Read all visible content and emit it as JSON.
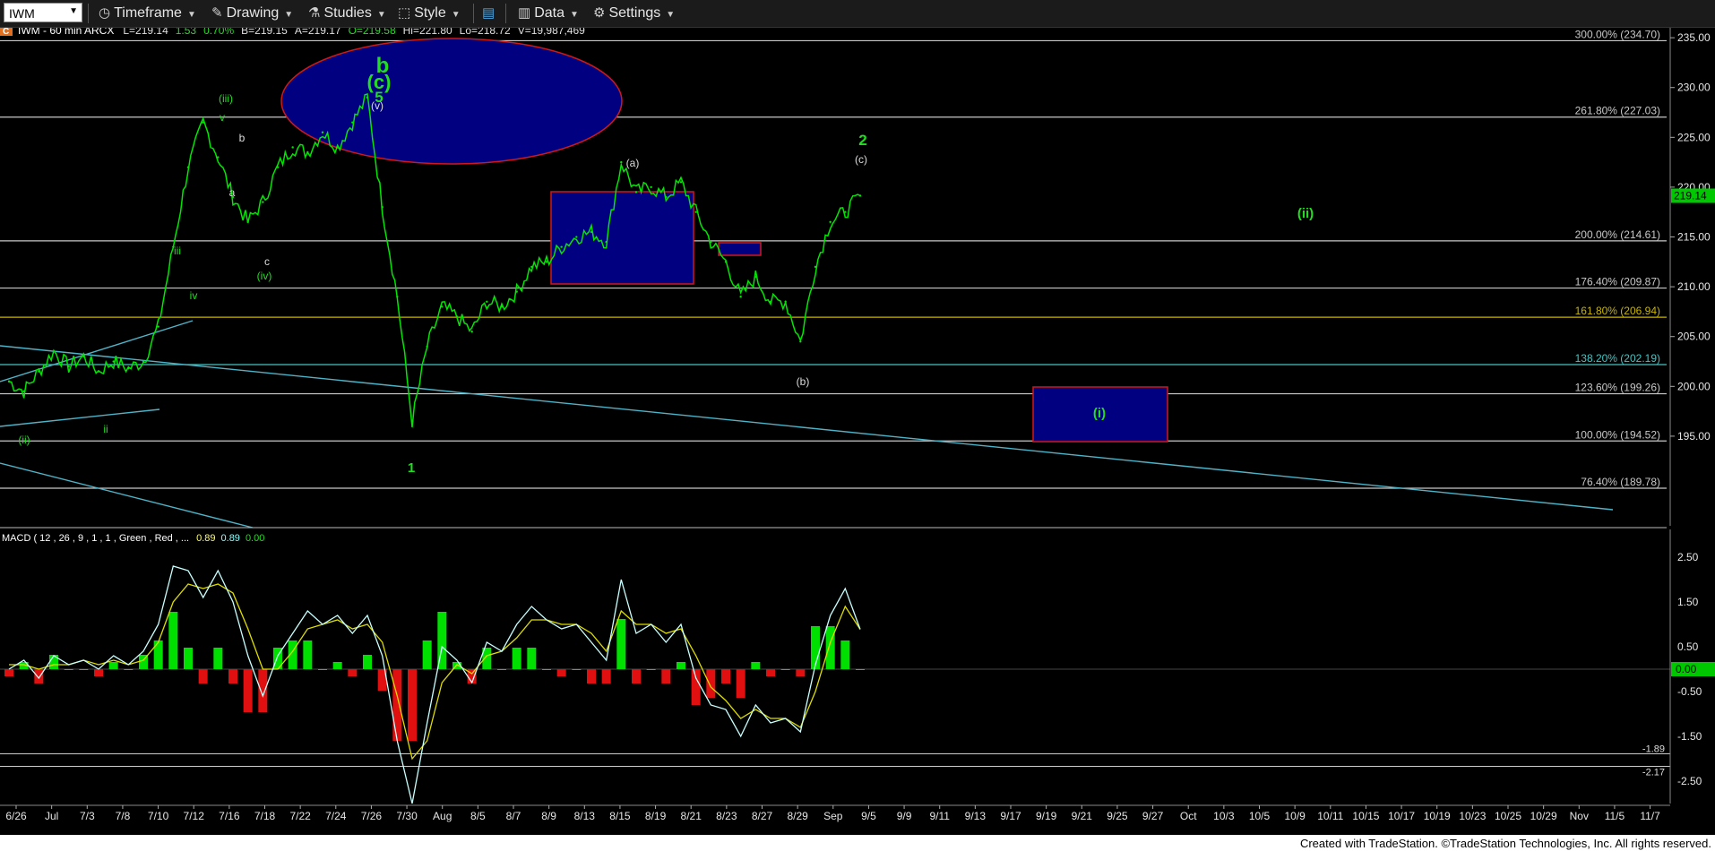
{
  "toolbar": {
    "symbol": "IWM",
    "timeframe_label": "Timeframe",
    "drawing_label": "Drawing",
    "studies_label": "Studies",
    "style_label": "Style",
    "data_label": "Data",
    "settings_label": "Settings",
    "icons": [
      "clock-icon",
      "pencil-icon",
      "flask-icon",
      "style-icon",
      "layout-icon",
      "bar-chart-icon",
      "gear-icon"
    ]
  },
  "header": {
    "marker": "C",
    "title": "IWM - 60 min  ARCX",
    "last": "L=219.14",
    "change": "1.53",
    "change_pct": "0.70%",
    "bid": "B=219.15",
    "ask": "A=219.17",
    "open": "O=219.58",
    "high": "Hi=221.80",
    "low": "Lo=218.72",
    "volume": "V=19,987,469"
  },
  "macd_header": {
    "label": "MACD ( 12 , 26 , 9 , 1 , 1 , Green , Red , ...",
    "v1": "0.89",
    "v2": "0.89",
    "v3": "0.00"
  },
  "colors": {
    "bg": "#000000",
    "price": "#00e600",
    "fib": "#c8c8c8",
    "fib_gold": "#c8b400",
    "fib_cyan": "#44c4c4",
    "box_fill": "#000080",
    "box_border": "#d01818",
    "trend": "#4fb3c8",
    "wave_green": "#22dd22",
    "wave_white": "#dddddd",
    "macd_pos": "#00e000",
    "macd_neg": "#e01010",
    "macd_line": "#c8ffff",
    "signal_line": "#dddd00"
  },
  "chart_data": {
    "type": "line",
    "ticker": "IWM",
    "interval": "60 min",
    "ylim": [
      186,
      236
    ],
    "y_ticks": [
      195,
      200,
      205,
      210,
      215,
      220,
      225,
      230,
      235
    ],
    "y_tick_labels": [
      "195.00",
      "200.00",
      "205.00",
      "210.00",
      "215.00",
      "220.00",
      "225.00",
      "230.00",
      "235.00"
    ],
    "last_price_tag": "219.14",
    "x_tick_labels": [
      "6/26",
      "Jul",
      "7/3",
      "7/8",
      "7/10",
      "7/12",
      "7/16",
      "7/18",
      "7/22",
      "7/24",
      "7/26",
      "7/30",
      "Aug",
      "8/5",
      "8/7",
      "8/9",
      "8/13",
      "8/15",
      "8/19",
      "8/21",
      "8/23",
      "8/27",
      "8/29",
      "Sep",
      "9/5",
      "9/9",
      "9/11",
      "9/13",
      "9/17",
      "9/19",
      "9/21",
      "9/25",
      "9/27",
      "Oct",
      "10/3",
      "10/5",
      "10/9",
      "10/11",
      "10/15",
      "10/17",
      "10/19",
      "10/23",
      "10/25",
      "10/29",
      "Nov",
      "11/5",
      "11/7"
    ],
    "fib_levels": [
      {
        "label": "300.00% (234.70)",
        "value": 234.7
      },
      {
        "label": "261.80% (227.03)",
        "value": 227.03
      },
      {
        "label": "200.00% (214.61)",
        "value": 214.61
      },
      {
        "label": "176.40% (209.87)",
        "value": 209.87
      },
      {
        "label": "161.80% (206.94)",
        "value": 206.94
      },
      {
        "label": "138.20% (202.19)",
        "value": 202.19
      },
      {
        "label": "123.60% (199.26)",
        "value": 199.26
      },
      {
        "label": "100.00% (194.52)",
        "value": 194.52
      },
      {
        "label": "76.40% (189.78)",
        "value": 189.78
      }
    ],
    "series": [
      {
        "x": [
          "6/26",
          "6/27",
          "6/28",
          "7/1",
          "7/2",
          "7/3",
          "7/5",
          "7/8",
          "7/9",
          "7/10",
          "7/11",
          "7/12",
          "7/15",
          "7/16",
          "7/17",
          "7/18",
          "7/19",
          "7/22",
          "7/23",
          "7/24",
          "7/25",
          "7/26",
          "7/29",
          "7/30",
          "7/31",
          "8/1",
          "8/2",
          "8/5",
          "8/6",
          "8/7",
          "8/8",
          "8/9",
          "8/12",
          "8/13",
          "8/14",
          "8/15",
          "8/16",
          "8/19",
          "8/20",
          "8/21",
          "8/22",
          "8/23",
          "8/26",
          "8/27",
          "8/28",
          "8/29",
          "8/30",
          "9/3",
          "9/4",
          "9/5",
          "9/6",
          "9/9",
          "9/10",
          "9/11",
          "9/12",
          "9/13",
          "9/16",
          "9/17"
        ],
        "y": [
          200.5,
          199.5,
          201.5,
          203.5,
          202.0,
          203.0,
          201.5,
          202.5,
          201.8,
          202.5,
          206.0,
          214.0,
          222.0,
          226.5,
          223.0,
          219.0,
          216.5,
          218.5,
          222.0,
          224.0,
          223.5,
          225.5,
          224.0,
          226.5,
          229.0,
          218.0,
          209.0,
          196.5,
          204.0,
          208.0,
          207.0,
          205.5,
          208.5,
          208.0,
          209.5,
          212.0,
          212.5,
          214.0,
          215.0,
          215.5,
          214.5,
          222.5,
          219.5,
          220.0,
          219.0,
          220.5,
          217.5,
          214.5,
          212.5,
          209.0,
          211.0,
          208.5,
          208.5,
          204.5,
          212.0,
          216.5,
          217.5,
          219.14
        ]
      }
    ],
    "macd": {
      "ylim": [
        -3.0,
        3.0
      ],
      "y_tick_labels": [
        "2.50",
        "1.50",
        "0.50",
        "-0.50",
        "-1.50",
        "-2.50"
      ],
      "y_ticks": [
        2.5,
        1.5,
        0.5,
        -0.5,
        -1.5,
        -2.5
      ],
      "current_tag": "0.00",
      "ref_labels": [
        "-1.89",
        "-2.17"
      ],
      "ref_values": [
        -1.89,
        -2.17
      ],
      "macd": [
        0.0,
        0.2,
        -0.2,
        0.3,
        0.1,
        0.2,
        0.0,
        0.3,
        0.1,
        0.4,
        1.0,
        2.3,
        2.2,
        1.6,
        2.2,
        1.5,
        0.3,
        -0.6,
        0.3,
        0.8,
        1.3,
        1.0,
        1.2,
        0.8,
        1.2,
        0.3,
        -1.6,
        -3.0,
        -1.2,
        0.5,
        0.2,
        -0.3,
        0.6,
        0.4,
        1.0,
        1.4,
        1.1,
        0.9,
        1.0,
        0.6,
        0.2,
        2.0,
        0.8,
        1.0,
        0.6,
        1.0,
        -0.2,
        -0.8,
        -0.9,
        -1.5,
        -0.8,
        -1.2,
        -1.1,
        -1.4,
        0.1,
        1.2,
        1.8,
        0.89
      ],
      "signal": [
        0.1,
        0.1,
        0.0,
        0.1,
        0.1,
        0.2,
        0.1,
        0.2,
        0.1,
        0.2,
        0.6,
        1.5,
        1.9,
        1.8,
        1.9,
        1.7,
        0.9,
        0.0,
        0.0,
        0.4,
        0.9,
        1.0,
        1.1,
        0.9,
        1.0,
        0.6,
        -0.6,
        -2.0,
        -1.6,
        -0.3,
        0.1,
        -0.1,
        0.3,
        0.4,
        0.7,
        1.1,
        1.1,
        1.0,
        1.0,
        0.8,
        0.4,
        1.3,
        1.0,
        1.0,
        0.8,
        0.9,
        0.3,
        -0.4,
        -0.7,
        -1.1,
        -0.9,
        -1.1,
        -1.1,
        -1.3,
        -0.5,
        0.6,
        1.4,
        0.89
      ]
    }
  },
  "annotations": {
    "wave_b": "b",
    "wave_c_paren": "(c)",
    "wave_5": "5",
    "wave_v_paren": "(v)",
    "wave_iii_paren": "(iii)",
    "wave_v_small": "v",
    "wave_b_small": "b",
    "wave_a_small": "a",
    "wave_c_small": "c",
    "wave_iv_paren": "(iv)",
    "wave_iii": "iii",
    "wave_iv": "iv",
    "wave_ii_paren": "(ii)",
    "wave_ii": "ii",
    "wave_1": "1",
    "wave_a_paren": "(a)",
    "wave_b_paren": "(b)",
    "wave_c_paren2": "(c)",
    "wave_2": "2",
    "wave_ii_target": "(ii)",
    "wave_i_target": "(i)"
  },
  "footer": {
    "credit": "Created with TradeStation. ©TradeStation Technologies, Inc. All rights reserved."
  }
}
